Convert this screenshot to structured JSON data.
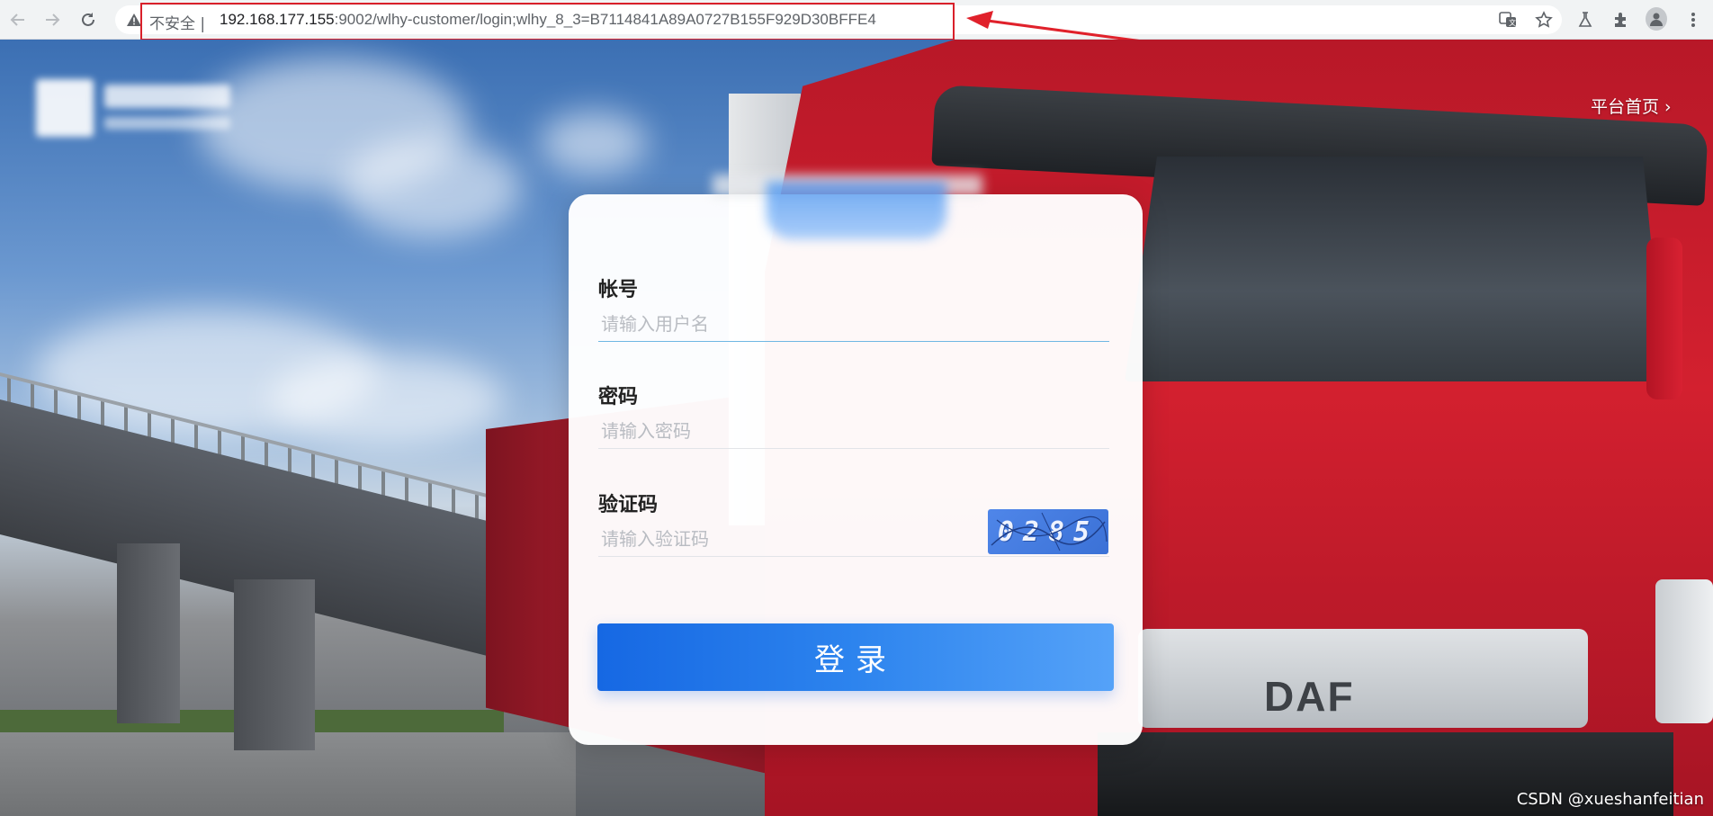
{
  "browser": {
    "security_label": "不安全 |",
    "url_host": "192.168.177.155",
    "url_rest": ":9002/wlhy-customer/login;wlhy_8_3=B7114841A89A0727B155F929D30BFFE4",
    "icons": [
      "back-arrow-icon",
      "forward-arrow-icon",
      "reload-icon",
      "warning-icon",
      "translate-icon",
      "star-icon",
      "lab-icon",
      "extensions-icon",
      "profile-icon",
      "menu-icon"
    ],
    "highlight_color": "#d9202a"
  },
  "header": {
    "platform_link": "平台首页 ›"
  },
  "login": {
    "username_label": "帐号",
    "username_placeholder": "请输入用户名",
    "password_label": "密码",
    "password_placeholder": "请输入密码",
    "captcha_label": "验证码",
    "captcha_placeholder": "请输入验证码",
    "captcha_value": "0285",
    "submit_label": "登录"
  },
  "background": {
    "truck_brand": "DAF"
  },
  "watermark": "CSDN @xueshanfeitian",
  "colors": {
    "accent": "#1668e3",
    "button_end": "#55a2f8",
    "input_active_line": "#6fb7e3"
  }
}
